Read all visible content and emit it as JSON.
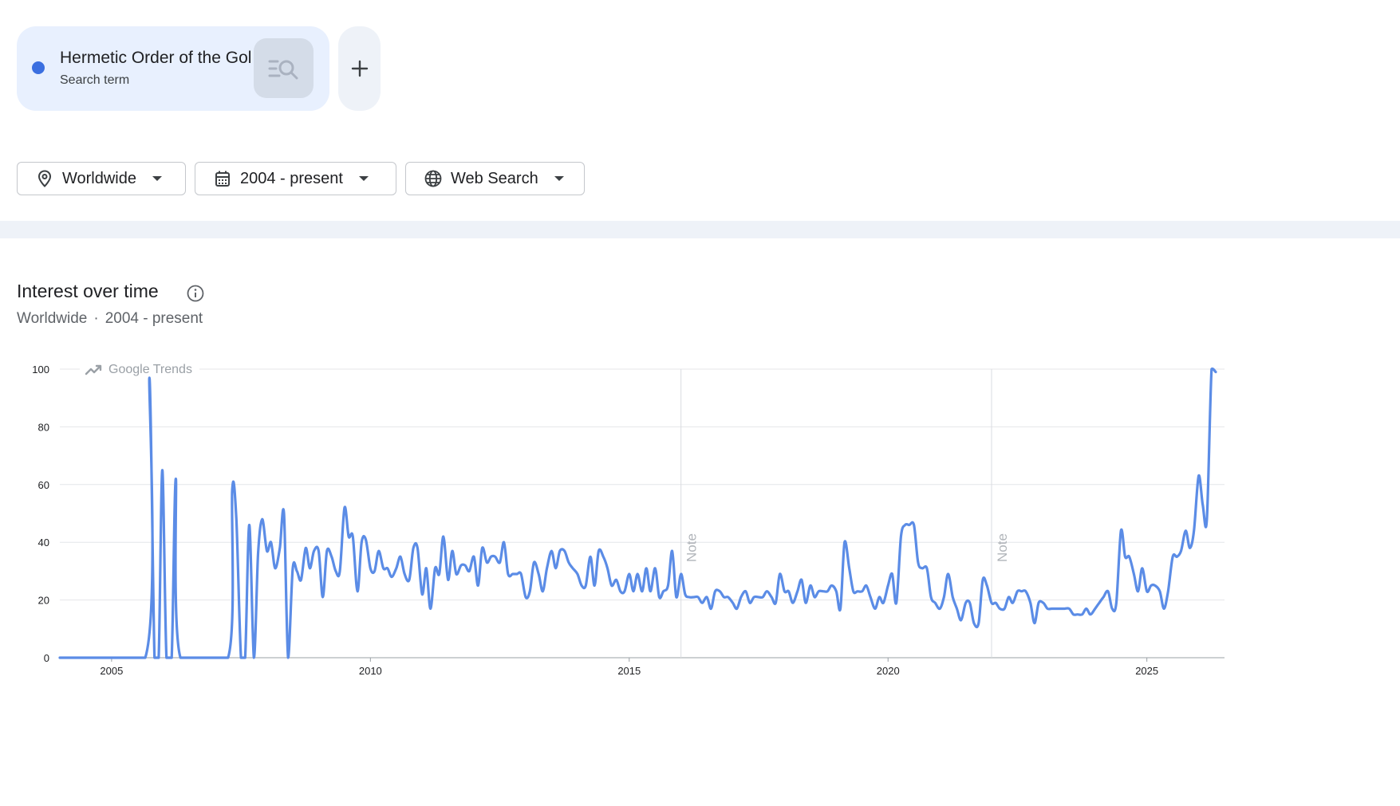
{
  "search_term": {
    "name": "Hermetic Order of the Golden Dawn",
    "type": "Search term",
    "color": "#3b6fe0",
    "action_icon": "search-refine-icon",
    "add_icon": "plus-icon"
  },
  "filters": {
    "location": {
      "label": "Worldwide",
      "icon": "location-pin-icon"
    },
    "time": {
      "label": "2004 - present",
      "icon": "calendar-icon"
    },
    "property": {
      "label": "Web Search",
      "icon": "globe-icon"
    }
  },
  "section": {
    "title": "Interest over time",
    "subtitle_location": "Worldwide",
    "subtitle_sep": "·",
    "subtitle_time": "2004 - present",
    "info_icon": "info-icon"
  },
  "watermark": "Google Trends",
  "chart_data": {
    "type": "line",
    "y_ticks": [
      "0",
      "20",
      "40",
      "60",
      "80",
      "100"
    ],
    "x_ticks": [
      "2005",
      "2010",
      "2015",
      "2020",
      "2025"
    ],
    "ylim": [
      0,
      100
    ],
    "xlim": [
      2004.0,
      2026.5
    ],
    "grid": true,
    "line_color": "#5b8ce6",
    "annotations": [
      {
        "label": "Note",
        "x": 2016.0
      },
      {
        "label": "Note",
        "x": 2022.0
      }
    ],
    "series": [
      {
        "points": [
          [
            2004.0,
            0
          ],
          [
            2005.65,
            0
          ],
          [
            2005.73,
            97
          ],
          [
            2005.83,
            0
          ],
          [
            2005.91,
            0
          ],
          [
            2005.98,
            65
          ],
          [
            2006.06,
            0
          ],
          [
            2006.16,
            0
          ],
          [
            2006.24,
            62
          ],
          [
            2006.33,
            0
          ],
          [
            2007.25,
            0
          ],
          [
            2007.33,
            58
          ],
          [
            2007.41,
            48
          ],
          [
            2007.5,
            0
          ],
          [
            2007.58,
            0
          ],
          [
            2007.66,
            46
          ],
          [
            2007.75,
            0
          ],
          [
            2007.83,
            36
          ],
          [
            2007.91,
            48
          ],
          [
            2008.0,
            37
          ],
          [
            2008.08,
            40
          ],
          [
            2008.16,
            31
          ],
          [
            2008.25,
            38
          ],
          [
            2008.33,
            50
          ],
          [
            2008.41,
            0
          ],
          [
            2008.5,
            31
          ],
          [
            2008.58,
            30
          ],
          [
            2008.66,
            27
          ],
          [
            2008.75,
            38
          ],
          [
            2008.83,
            31
          ],
          [
            2008.91,
            37
          ],
          [
            2009.0,
            37
          ],
          [
            2009.08,
            21
          ],
          [
            2009.16,
            37
          ],
          [
            2009.25,
            35
          ],
          [
            2009.33,
            30
          ],
          [
            2009.41,
            30
          ],
          [
            2009.5,
            52
          ],
          [
            2009.58,
            42
          ],
          [
            2009.66,
            42
          ],
          [
            2009.75,
            23
          ],
          [
            2009.83,
            40
          ],
          [
            2009.91,
            41
          ],
          [
            2010.0,
            31
          ],
          [
            2010.08,
            30
          ],
          [
            2010.16,
            37
          ],
          [
            2010.25,
            31
          ],
          [
            2010.33,
            31
          ],
          [
            2010.41,
            28
          ],
          [
            2010.5,
            31
          ],
          [
            2010.58,
            35
          ],
          [
            2010.66,
            29
          ],
          [
            2010.75,
            27
          ],
          [
            2010.83,
            38
          ],
          [
            2010.91,
            38
          ],
          [
            2011.0,
            22
          ],
          [
            2011.08,
            31
          ],
          [
            2011.16,
            17
          ],
          [
            2011.25,
            31
          ],
          [
            2011.33,
            29
          ],
          [
            2011.41,
            42
          ],
          [
            2011.5,
            27
          ],
          [
            2011.58,
            37
          ],
          [
            2011.66,
            29
          ],
          [
            2011.75,
            32
          ],
          [
            2011.83,
            32
          ],
          [
            2011.91,
            30
          ],
          [
            2012.0,
            35
          ],
          [
            2012.08,
            25
          ],
          [
            2012.16,
            38
          ],
          [
            2012.25,
            33
          ],
          [
            2012.33,
            35
          ],
          [
            2012.41,
            35
          ],
          [
            2012.5,
            33
          ],
          [
            2012.58,
            40
          ],
          [
            2012.66,
            29
          ],
          [
            2012.75,
            29
          ],
          [
            2012.83,
            29
          ],
          [
            2012.91,
            29
          ],
          [
            2013.0,
            21
          ],
          [
            2013.08,
            23
          ],
          [
            2013.16,
            33
          ],
          [
            2013.25,
            29
          ],
          [
            2013.33,
            23
          ],
          [
            2013.41,
            31
          ],
          [
            2013.5,
            37
          ],
          [
            2013.58,
            31
          ],
          [
            2013.66,
            37
          ],
          [
            2013.75,
            37
          ],
          [
            2013.83,
            33
          ],
          [
            2013.91,
            31
          ],
          [
            2014.0,
            29
          ],
          [
            2014.08,
            25
          ],
          [
            2014.16,
            25
          ],
          [
            2014.25,
            35
          ],
          [
            2014.33,
            25
          ],
          [
            2014.41,
            37
          ],
          [
            2014.5,
            35
          ],
          [
            2014.58,
            31
          ],
          [
            2014.66,
            25
          ],
          [
            2014.75,
            27
          ],
          [
            2014.83,
            23
          ],
          [
            2014.91,
            23
          ],
          [
            2015.0,
            29
          ],
          [
            2015.08,
            23
          ],
          [
            2015.16,
            29
          ],
          [
            2015.25,
            23
          ],
          [
            2015.33,
            31
          ],
          [
            2015.41,
            23
          ],
          [
            2015.5,
            31
          ],
          [
            2015.58,
            21
          ],
          [
            2015.66,
            23
          ],
          [
            2015.75,
            25
          ],
          [
            2015.83,
            37
          ],
          [
            2015.91,
            21
          ],
          [
            2016.0,
            29
          ],
          [
            2016.08,
            22
          ],
          [
            2016.16,
            21
          ],
          [
            2016.25,
            21
          ],
          [
            2016.33,
            21
          ],
          [
            2016.41,
            19
          ],
          [
            2016.5,
            21
          ],
          [
            2016.58,
            17
          ],
          [
            2016.66,
            23
          ],
          [
            2016.75,
            23
          ],
          [
            2016.83,
            21
          ],
          [
            2016.91,
            21
          ],
          [
            2017.0,
            19
          ],
          [
            2017.08,
            17
          ],
          [
            2017.16,
            21
          ],
          [
            2017.25,
            23
          ],
          [
            2017.33,
            19
          ],
          [
            2017.41,
            21
          ],
          [
            2017.5,
            21
          ],
          [
            2017.58,
            21
          ],
          [
            2017.66,
            23
          ],
          [
            2017.75,
            21
          ],
          [
            2017.83,
            19
          ],
          [
            2017.91,
            29
          ],
          [
            2018.0,
            23
          ],
          [
            2018.08,
            23
          ],
          [
            2018.16,
            19
          ],
          [
            2018.25,
            23
          ],
          [
            2018.33,
            27
          ],
          [
            2018.41,
            19
          ],
          [
            2018.5,
            25
          ],
          [
            2018.58,
            21
          ],
          [
            2018.66,
            23
          ],
          [
            2018.75,
            23
          ],
          [
            2018.83,
            23
          ],
          [
            2018.91,
            25
          ],
          [
            2019.0,
            23
          ],
          [
            2019.08,
            17
          ],
          [
            2019.16,
            40
          ],
          [
            2019.25,
            31
          ],
          [
            2019.33,
            23
          ],
          [
            2019.41,
            23
          ],
          [
            2019.5,
            23
          ],
          [
            2019.58,
            25
          ],
          [
            2019.66,
            21
          ],
          [
            2019.75,
            17
          ],
          [
            2019.83,
            21
          ],
          [
            2019.91,
            19
          ],
          [
            2020.0,
            25
          ],
          [
            2020.08,
            29
          ],
          [
            2020.16,
            19
          ],
          [
            2020.25,
            42
          ],
          [
            2020.33,
            46
          ],
          [
            2020.41,
            46
          ],
          [
            2020.5,
            46
          ],
          [
            2020.58,
            33
          ],
          [
            2020.66,
            31
          ],
          [
            2020.75,
            31
          ],
          [
            2020.83,
            21
          ],
          [
            2020.91,
            19
          ],
          [
            2021.0,
            17
          ],
          [
            2021.08,
            21
          ],
          [
            2021.16,
            29
          ],
          [
            2021.25,
            21
          ],
          [
            2021.33,
            17
          ],
          [
            2021.41,
            13
          ],
          [
            2021.5,
            19
          ],
          [
            2021.58,
            19
          ],
          [
            2021.66,
            12
          ],
          [
            2021.75,
            12
          ],
          [
            2021.83,
            27
          ],
          [
            2021.91,
            25
          ],
          [
            2022.0,
            19
          ],
          [
            2022.08,
            19
          ],
          [
            2022.16,
            17
          ],
          [
            2022.25,
            17
          ],
          [
            2022.33,
            21
          ],
          [
            2022.41,
            19
          ],
          [
            2022.5,
            23
          ],
          [
            2022.58,
            23
          ],
          [
            2022.66,
            23
          ],
          [
            2022.75,
            19
          ],
          [
            2022.83,
            12
          ],
          [
            2022.91,
            19
          ],
          [
            2023.0,
            19
          ],
          [
            2023.08,
            17
          ],
          [
            2023.16,
            17
          ],
          [
            2023.25,
            17
          ],
          [
            2023.33,
            17
          ],
          [
            2023.41,
            17
          ],
          [
            2023.5,
            17
          ],
          [
            2023.58,
            15
          ],
          [
            2023.66,
            15
          ],
          [
            2023.75,
            15
          ],
          [
            2023.83,
            17
          ],
          [
            2023.91,
            15
          ],
          [
            2024.0,
            17
          ],
          [
            2024.08,
            19
          ],
          [
            2024.16,
            21
          ],
          [
            2024.25,
            23
          ],
          [
            2024.33,
            17
          ],
          [
            2024.41,
            19
          ],
          [
            2024.5,
            44
          ],
          [
            2024.58,
            35
          ],
          [
            2024.66,
            35
          ],
          [
            2024.75,
            29
          ],
          [
            2024.83,
            23
          ],
          [
            2024.91,
            31
          ],
          [
            2025.0,
            23
          ],
          [
            2025.08,
            25
          ],
          [
            2025.16,
            25
          ],
          [
            2025.25,
            23
          ],
          [
            2025.33,
            17
          ],
          [
            2025.41,
            23
          ],
          [
            2025.5,
            35
          ],
          [
            2025.58,
            35
          ],
          [
            2025.66,
            37
          ],
          [
            2025.75,
            44
          ],
          [
            2025.83,
            38
          ],
          [
            2025.91,
            44
          ],
          [
            2026.0,
            63
          ],
          [
            2026.08,
            53
          ],
          [
            2026.16,
            48
          ],
          [
            2026.25,
            100
          ],
          [
            2026.33,
            99
          ]
        ]
      }
    ]
  }
}
